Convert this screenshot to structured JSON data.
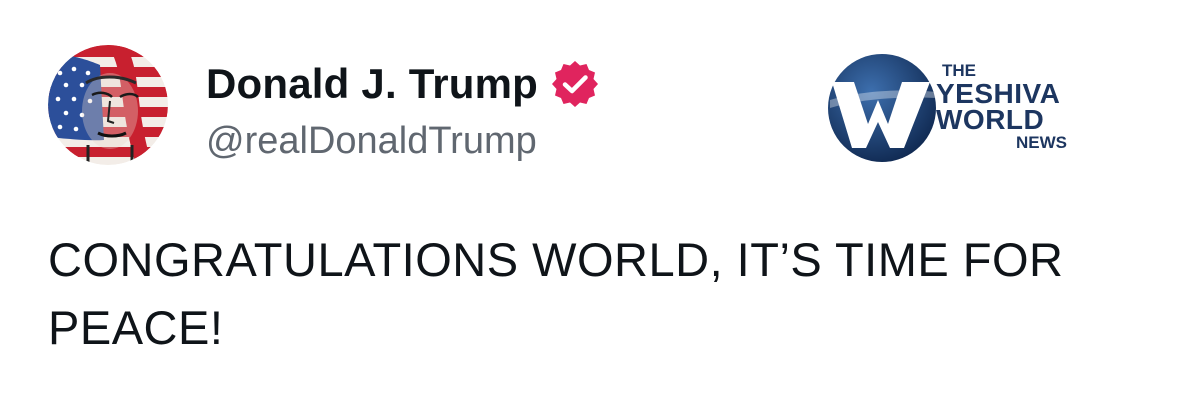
{
  "author": {
    "display_name": "Donald J. Trump",
    "handle": "@realDonaldTrump",
    "verified": true,
    "verified_color": "#e0245e",
    "avatar_icon": "flag-portrait-avatar"
  },
  "watermark": {
    "line1": "THE",
    "line2": "YESHIVA",
    "line3": "WORLD",
    "line4": "NEWS",
    "brand_color": "#1d3660"
  },
  "post": {
    "text": "CONGRATULATIONS WORLD, IT’S TIME FOR PEACE!"
  }
}
